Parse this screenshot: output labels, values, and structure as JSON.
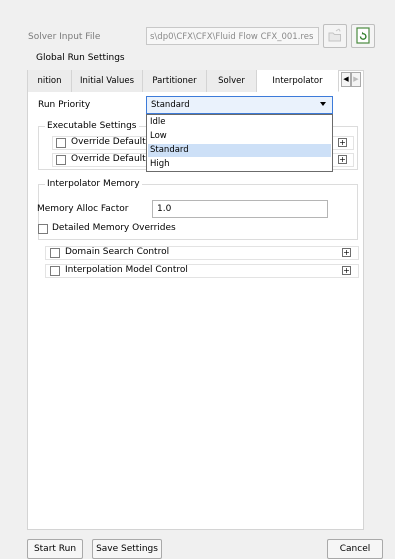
{
  "top": {
    "input_label": "Solver Input File",
    "input_value": "s\\dp0\\CFX\\CFX\\Fluid Flow CFX_001.res"
  },
  "group": {
    "title": "Global Run Settings"
  },
  "tabs": [
    {
      "label": "nition"
    },
    {
      "label": "Initial Values"
    },
    {
      "label": "Partitioner"
    },
    {
      "label": "Solver"
    },
    {
      "label": "Interpolator"
    }
  ],
  "run_priority": {
    "label": "Run Priority",
    "value": "Standard",
    "options": [
      "Idle",
      "Low",
      "Standard",
      "High"
    ]
  },
  "executable_settings": {
    "title": "Executable Settings",
    "items": [
      {
        "label": "Override Default"
      },
      {
        "label": "Override Default"
      }
    ]
  },
  "interpolator_memory": {
    "title": "Interpolator Memory",
    "factor_label": "Memory Alloc Factor",
    "factor_value": "1.0"
  },
  "checks": {
    "detailed": "Detailed Memory Overrides",
    "domain_search": "Domain Search Control",
    "interp_model": "Interpolation Model Control"
  },
  "buttons": {
    "start": "Start Run",
    "save": "Save Settings",
    "cancel": "Cancel"
  }
}
